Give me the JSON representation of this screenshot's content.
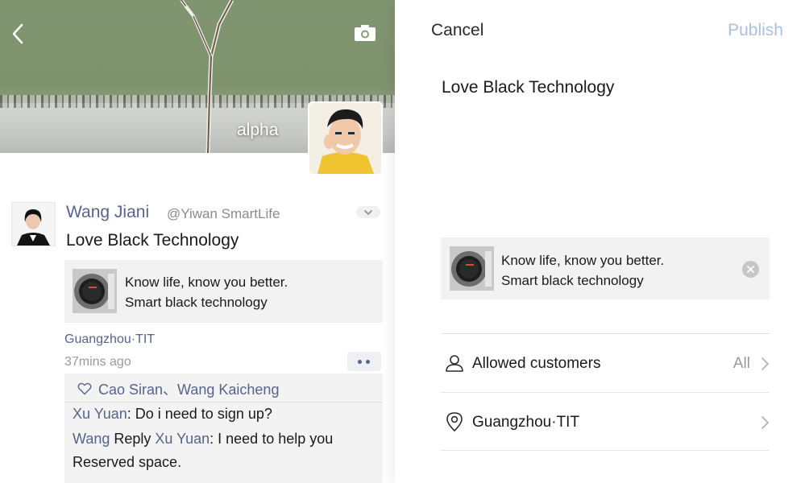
{
  "left_panel": {
    "cover": {
      "name": "alpha",
      "back_icon": "chevron-left-icon",
      "camera_icon": "camera-icon"
    },
    "post": {
      "author": "Wang Jiani",
      "handle": "@Yiwan SmartLife",
      "text": "Love Black Technology",
      "shared": {
        "line1": "Know life, know you better.",
        "line2": "Smart black technology"
      },
      "location": "Guangzhou·TIT",
      "time": "37mins ago",
      "likes": "Cao Siran、Wang Kaicheng",
      "comments": [
        {
          "author": "Xu Yuan",
          "text": ": Do i need to sign up?"
        },
        {
          "author": "Wang",
          "reply_word": " Reply ",
          "reply_to": "Xu Yuan",
          "text": ": I need to help you",
          "text_cont": "Reserved space."
        }
      ]
    }
  },
  "right_panel": {
    "cancel_label": "Cancel",
    "publish_label": "Publish",
    "compose_text": "Love Black Technology",
    "attachment": {
      "line1": "Know life, know you better.",
      "line2": "Smart black technology"
    },
    "rows": [
      {
        "icon": "person-icon",
        "label": "Allowed customers",
        "value": "All"
      },
      {
        "icon": "location-pin-icon",
        "label": "Guangzhou·TIT",
        "value": ""
      }
    ]
  },
  "colors": {
    "link": "#56648c",
    "publish_disabled": "#a9c0df",
    "card_bg": "#f2f2f2"
  }
}
